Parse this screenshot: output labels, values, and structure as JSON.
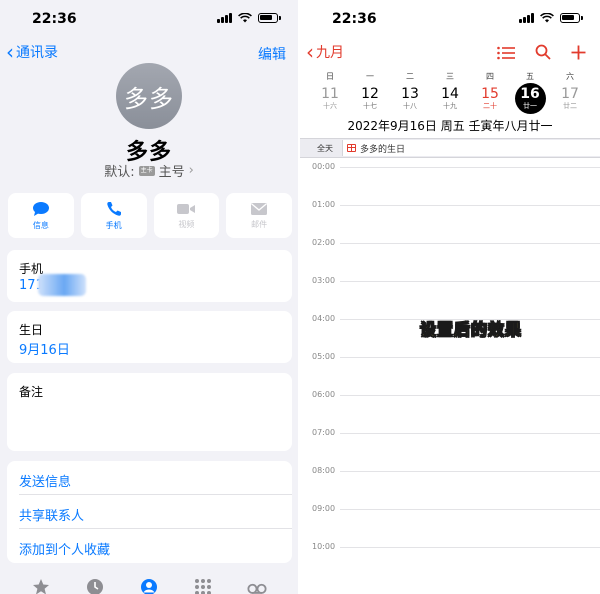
{
  "contact": {
    "status_time": "22:36",
    "back_label": "通讯录",
    "edit_label": "编辑",
    "avatar_text": "多多",
    "name": "多多",
    "default_label": "默认:",
    "default_badge": "主卡",
    "default_value": "主号",
    "actions": [
      {
        "label": "信息",
        "icon": "message-icon",
        "enabled": true
      },
      {
        "label": "手机",
        "icon": "phone-icon",
        "enabled": true
      },
      {
        "label": "视频",
        "icon": "video-icon",
        "enabled": false
      },
      {
        "label": "邮件",
        "icon": "mail-icon",
        "enabled": false
      }
    ],
    "phone": {
      "label": "手机",
      "value": "171"
    },
    "birthday": {
      "label": "生日",
      "value": "9月16日"
    },
    "notes": {
      "label": "备注"
    },
    "links": [
      "发送信息",
      "共享联系人",
      "添加到个人收藏"
    ],
    "tabbar_icons": [
      "star-icon",
      "clock-icon",
      "person-icon",
      "keypad-icon",
      "voicemail-icon"
    ]
  },
  "calendar": {
    "status_time": "22:36",
    "month_label": "九月",
    "weekdays": [
      "日",
      "一",
      "二",
      "三",
      "四",
      "五",
      "六"
    ],
    "days": [
      {
        "num": "11",
        "lunar": "十六",
        "type": "weekend"
      },
      {
        "num": "12",
        "lunar": "十七",
        "type": "normal"
      },
      {
        "num": "13",
        "lunar": "十八",
        "type": "normal"
      },
      {
        "num": "14",
        "lunar": "十九",
        "type": "normal"
      },
      {
        "num": "15",
        "lunar": "二十",
        "type": "holiday"
      },
      {
        "num": "16",
        "lunar": "廿一",
        "type": "selected"
      },
      {
        "num": "17",
        "lunar": "廿二",
        "type": "weekend"
      }
    ],
    "date_line": "2022年9月16日 周五  壬寅年八月廿一",
    "allday_label": "全天",
    "event_title": "多多的生日",
    "hours": [
      "00:00",
      "01:00",
      "02:00",
      "03:00",
      "04:00",
      "05:00",
      "06:00",
      "07:00",
      "08:00",
      "09:00",
      "10:00"
    ],
    "caption": "设置后的效果"
  },
  "colors": {
    "ios_blue": "#0a7aff",
    "calendar_red": "#e23b2d",
    "caption_yellow": "#f6e45a"
  }
}
